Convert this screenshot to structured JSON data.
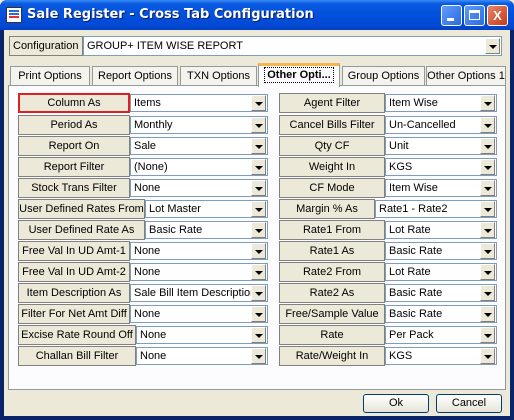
{
  "window": {
    "title": "Sale Register - Cross Tab Configuration",
    "controls": {
      "minimize": "_",
      "maximize": "□",
      "close": "X"
    }
  },
  "configuration": {
    "label": "Configuration",
    "value": "GROUP+ ITEM WISE REPORT"
  },
  "tabs": [
    {
      "label": "Print Options",
      "active": false
    },
    {
      "label": "Report Options",
      "active": false
    },
    {
      "label": "TXN Options",
      "active": false
    },
    {
      "label": "Other Opti...",
      "active": true
    },
    {
      "label": "Group Options",
      "active": false
    },
    {
      "label": "Other Options 1",
      "active": false
    }
  ],
  "left": [
    {
      "label": "Column As",
      "value": "Items"
    },
    {
      "label": "Period As",
      "value": "Monthly"
    },
    {
      "label": "Report On",
      "value": "Sale"
    },
    {
      "label": "Report Filter",
      "value": "(None)"
    },
    {
      "label": "Stock Trans Filter",
      "value": "None"
    },
    {
      "label": "User Defined Rates From",
      "value": "Lot Master"
    },
    {
      "label": "User Defined Rate As",
      "value": "Basic Rate"
    },
    {
      "label": "Free Val In UD Amt-1",
      "value": "None"
    },
    {
      "label": "Free Val In UD Amt-2",
      "value": "None"
    },
    {
      "label": "Item Description As",
      "value": "Sale Bill Item Description"
    },
    {
      "label": "Filter For Net Amt Diff",
      "value": "None"
    },
    {
      "label": "Excise Rate Round Off",
      "value": "None"
    },
    {
      "label": "Challan Bill Filter",
      "value": "None"
    }
  ],
  "right": [
    {
      "label": "Agent Filter",
      "value": "Item Wise"
    },
    {
      "label": "Cancel Bills Filter",
      "value": "Un-Cancelled"
    },
    {
      "label": "Qty CF",
      "value": "Unit"
    },
    {
      "label": "Weight In",
      "value": "KGS"
    },
    {
      "label": "CF Mode",
      "value": "Item Wise"
    },
    {
      "label": "Margin % As",
      "value": "Rate1 - Rate2"
    },
    {
      "label": "Rate1 From",
      "value": "Lot Rate"
    },
    {
      "label": "Rate1 As",
      "value": "Basic Rate"
    },
    {
      "label": "Rate2 From",
      "value": "Lot Rate"
    },
    {
      "label": "Rate2 As",
      "value": "Basic Rate"
    },
    {
      "label": "Free/Sample Value",
      "value": "Basic Rate"
    },
    {
      "label": "Rate",
      "value": "Per Pack"
    },
    {
      "label": "Rate/Weight In",
      "value": "KGS"
    }
  ],
  "buttons": {
    "ok": "Ok",
    "cancel": "Cancel"
  }
}
